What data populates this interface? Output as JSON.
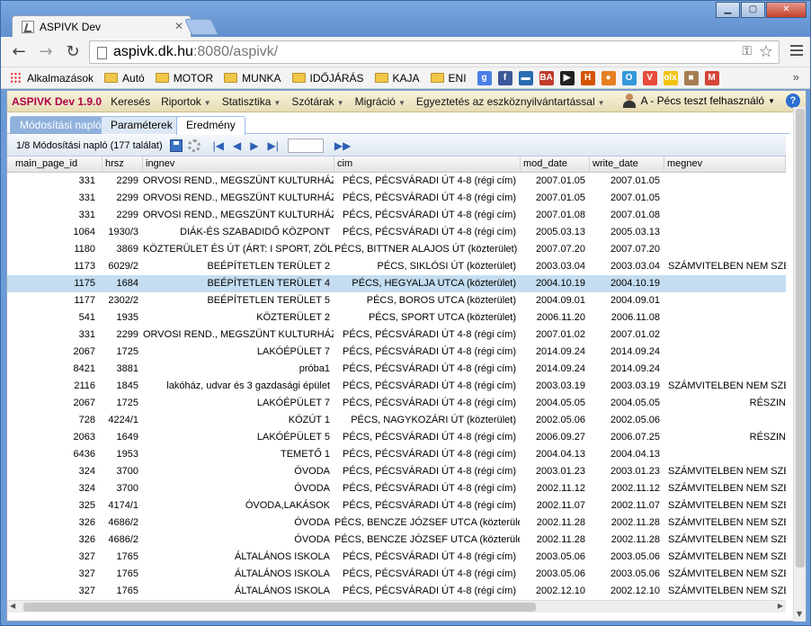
{
  "browser": {
    "tab_title": "ASPIVK Dev",
    "url_host": "aspivk.dk.hu",
    "url_rest": ":8080/aspivk/",
    "bookmarks": [
      {
        "label": "Alkalmazások",
        "icon": "apps-icon"
      },
      {
        "label": "Autó",
        "icon": "folder-icon"
      },
      {
        "label": "MOTOR",
        "icon": "folder-icon"
      },
      {
        "label": "MUNKA",
        "icon": "folder-icon"
      },
      {
        "label": "IDŐJÁRÁS",
        "icon": "folder-icon"
      },
      {
        "label": "KAJA",
        "icon": "folder-icon"
      },
      {
        "label": "ENI",
        "icon": "folder-icon"
      }
    ],
    "bookmark_icons": [
      {
        "name": "google-icon",
        "glyph": "g",
        "color": "#4a7fe6"
      },
      {
        "name": "facebook-icon",
        "glyph": "f",
        "color": "#3b5998"
      },
      {
        "name": "bookmark-app-icon",
        "glyph": "▬",
        "color": "#2b6cb0"
      },
      {
        "name": "ba-icon",
        "glyph": "BA",
        "color": "#c0392b"
      },
      {
        "name": "play-icon",
        "glyph": "▶",
        "color": "#222"
      },
      {
        "name": "h-icon",
        "glyph": "H",
        "color": "#d35400"
      },
      {
        "name": "ring-icon",
        "glyph": "●",
        "color": "#e67e22"
      },
      {
        "name": "o-icon",
        "glyph": "O",
        "color": "#3498db"
      },
      {
        "name": "v-icon",
        "glyph": "V",
        "color": "#e74c3c"
      },
      {
        "name": "olx-icon",
        "glyph": "olx",
        "color": "#f1c40f"
      },
      {
        "name": "box-icon",
        "glyph": "■",
        "color": "#a67c52"
      },
      {
        "name": "gmail-icon",
        "glyph": "M",
        "color": "#d44638"
      }
    ]
  },
  "app": {
    "brand": "ASPIVK Dev 1.9.0",
    "menu": [
      "Keresés",
      "Riportok",
      "Statisztika",
      "Szótárak",
      "Migráció",
      "Egyeztetés az eszköznyilvántartással"
    ],
    "menu_has_caret": [
      false,
      true,
      true,
      true,
      true,
      true
    ],
    "user": "A - Pécs teszt felhasználó",
    "tabs": [
      "Módosítási napló",
      "Paraméterek",
      "Eredmény"
    ],
    "grid_toolbar_text": "1/8  Módosítási napló (177 találat)",
    "columns": [
      "main_page_id",
      "hrsz",
      "ingnev",
      "cim",
      "mod_date",
      "write_date",
      "megnev"
    ],
    "selected_row_index": 6,
    "rows": [
      [
        "331",
        "2299",
        "ORVOSI REND., MEGSZÜNT KULTURHÁZ",
        "PÉCS, PÉCSVÁRADI ÚT 4-8 (régi cím)",
        "2007.01.05",
        "2007.01.05",
        ""
      ],
      [
        "331",
        "2299",
        "ORVOSI REND., MEGSZÜNT KULTURHÁZ",
        "PÉCS, PÉCSVÁRADI ÚT 4-8 (régi cím)",
        "2007.01.05",
        "2007.01.05",
        ""
      ],
      [
        "331",
        "2299",
        "ORVOSI REND., MEGSZÜNT KULTURHÁZ",
        "PÉCS, PÉCSVÁRADI ÚT 4-8 (régi cím)",
        "2007.01.08",
        "2007.01.08",
        ""
      ],
      [
        "1064",
        "1930/3",
        "DIÁK-ÉS SZABADIDŐ KÖZPONT",
        "PÉCS, PÉCSVÁRADI ÚT 4-8 (régi cím)",
        "2005.03.13",
        "2005.03.13",
        ""
      ],
      [
        "1180",
        "3869",
        "KÖZTERÜLET ÉS ÚT (ÁRT: I SPORT, ZÖLD)",
        "PÉCS, BITTNER ALAJOS ÚT (közterület)",
        "2007.07.20",
        "2007.07.20",
        ""
      ],
      [
        "1173",
        "6029/2",
        "BEÉPÍTETLEN TERÜLET 2",
        "PÉCS, SIKLÓSI ÚT (közterület)",
        "2003.03.04",
        "2003.03.04",
        "SZÁMVITELBEN NEM SZERE"
      ],
      [
        "1175",
        "1684",
        "BEÉPÍTETLEN TERÜLET 4",
        "PÉCS, HEGYALJA UTCA (közterület)",
        "2004.10.19",
        "2004.10.19",
        ""
      ],
      [
        "1177",
        "2302/2",
        "BEÉPÍTETLEN TERÜLET 5",
        "PÉCS, BOROS UTCA (közterület)",
        "2004.09.01",
        "2004.09.01",
        ""
      ],
      [
        "541",
        "1935",
        "KÖZTERÜLET 2",
        "PÉCS, SPORT UTCA (közterület)",
        "2006.11.20",
        "2006.11.08",
        ""
      ],
      [
        "331",
        "2299",
        "ORVOSI REND., MEGSZÜNT KULTURHÁZ",
        "PÉCS, PÉCSVÁRADI ÚT 4-8 (régi cím)",
        "2007.01.02",
        "2007.01.02",
        ""
      ],
      [
        "2067",
        "1725",
        "LAKÓÉPÜLET 7",
        "PÉCS, PÉCSVÁRADI ÚT 4-8 (régi cím)",
        "2014.09.24",
        "2014.09.24",
        ""
      ],
      [
        "8421",
        "3881",
        "próba1",
        "PÉCS, PÉCSVÁRADI ÚT 4-8 (régi cím)",
        "2014.09.24",
        "2014.09.24",
        ""
      ],
      [
        "2116",
        "1845",
        "lakóház, udvar és 3 gazdasági épület",
        "PÉCS, PÉCSVÁRADI ÚT 4-8 (régi cím)",
        "2003.03.19",
        "2003.03.19",
        "SZÁMVITELBEN NEM SZERE"
      ],
      [
        "2067",
        "1725",
        "LAKÓÉPÜLET 7",
        "PÉCS, PÉCSVÁRADI ÚT 4-8 (régi cím)",
        "2004.05.05",
        "2004.05.05",
        "RÉSZIN"
      ],
      [
        "728",
        "4224/1",
        "KÖZÚT 1",
        "PÉCS, NAGYKOZÁRI ÚT (közterület)",
        "2002.05.06",
        "2002.05.06",
        ""
      ],
      [
        "2063",
        "1649",
        "LAKÓÉPÜLET 5",
        "PÉCS, PÉCSVÁRADI ÚT 4-8 (régi cím)",
        "2006.09.27",
        "2006.07.25",
        "RÉSZIN"
      ],
      [
        "6436",
        "1953",
        "TEMETŐ 1",
        "PÉCS, PÉCSVÁRADI ÚT 4-8 (régi cím)",
        "2004.04.13",
        "2004.04.13",
        ""
      ],
      [
        "324",
        "3700",
        "ÓVODA",
        "PÉCS, PÉCSVÁRADI ÚT 4-8 (régi cím)",
        "2003.01.23",
        "2003.01.23",
        "SZÁMVITELBEN NEM SZERE"
      ],
      [
        "324",
        "3700",
        "ÓVODA",
        "PÉCS, PÉCSVÁRADI ÚT 4-8 (régi cím)",
        "2002.11.12",
        "2002.11.12",
        "SZÁMVITELBEN NEM SZERE"
      ],
      [
        "325",
        "4174/1",
        "ÓVODA,LAKÁSOK",
        "PÉCS, PÉCSVÁRADI ÚT 4-8 (régi cím)",
        "2002.11.07",
        "2002.11.07",
        "SZÁMVITELBEN NEM SZERE"
      ],
      [
        "326",
        "4686/2",
        "ÓVODA",
        "PÉCS, BENCZE JÓZSEF UTCA (közterület)",
        "2002.11.28",
        "2002.11.28",
        "SZÁMVITELBEN NEM SZERE"
      ],
      [
        "326",
        "4686/2",
        "ÓVODA",
        "PÉCS, BENCZE JÓZSEF UTCA (közterület)",
        "2002.11.28",
        "2002.11.28",
        "SZÁMVITELBEN NEM SZERE"
      ],
      [
        "327",
        "1765",
        "ÁLTALÁNOS ISKOLA",
        "PÉCS, PÉCSVÁRADI ÚT 4-8 (régi cím)",
        "2003.05.06",
        "2003.05.06",
        "SZÁMVITELBEN NEM SZERE"
      ],
      [
        "327",
        "1765",
        "ÁLTALÁNOS ISKOLA",
        "PÉCS, PÉCSVÁRADI ÚT 4-8 (régi cím)",
        "2003.05.06",
        "2003.05.06",
        "SZÁMVITELBEN NEM SZERE"
      ],
      [
        "327",
        "1765",
        "ÁLTALÁNOS ISKOLA",
        "PÉCS, PÉCSVÁRADI ÚT 4-8 (régi cím)",
        "2002.12.10",
        "2002.12.10",
        "SZÁMVITELBEN NEM SZERE"
      ]
    ],
    "colors": {
      "brand": "#b0004a",
      "selected_row": "#c4ddf1",
      "active_tab": "#8fb1dc"
    }
  }
}
